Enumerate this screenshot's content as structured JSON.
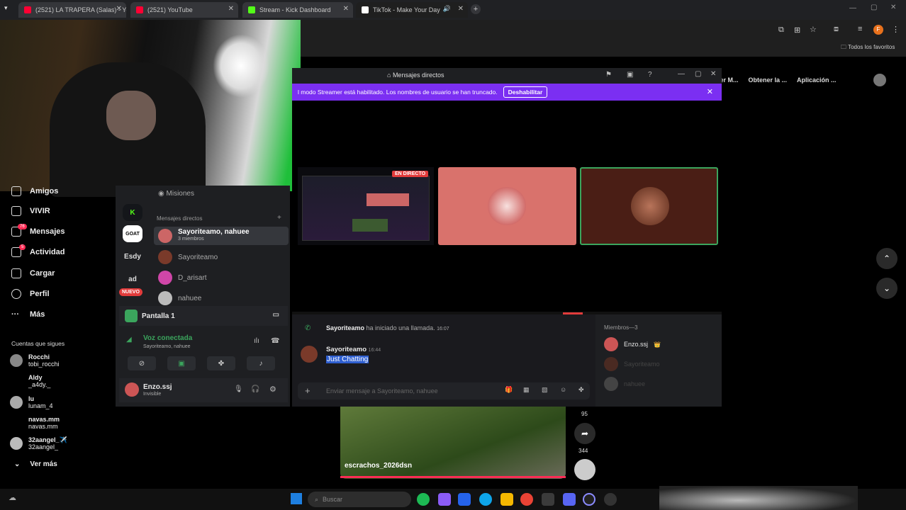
{
  "browser": {
    "tabs": [
      {
        "title": "(2521) LA TRAPERA (Salas) - Yo",
        "color": "#ff0033"
      },
      {
        "title": "(2521) YouTube",
        "color": "#ff0033"
      },
      {
        "title": "Stream - Kick Dashboard",
        "color": "#53fc18"
      },
      {
        "title": "TikTok - Make Your Day",
        "color": "#ffffff"
      }
    ],
    "bookmarks_label": "Todos los favoritos",
    "bookmarks": [
      "ner M...",
      "Obtener la ...",
      "Aplicación ..."
    ],
    "profile_initial": "F"
  },
  "tiktok_sidebar": {
    "items": [
      {
        "label": "Amigos",
        "icon": "friends-icon",
        "badge": ""
      },
      {
        "label": "VIVIR",
        "icon": "live-icon",
        "badge": ""
      },
      {
        "label": "Mensajes",
        "icon": "messages-icon",
        "badge": "76"
      },
      {
        "label": "Actividad",
        "icon": "activity-icon",
        "badge": "5"
      },
      {
        "label": "Cargar",
        "icon": "upload-icon",
        "badge": ""
      },
      {
        "label": "Perfil",
        "icon": "profile-icon",
        "badge": ""
      },
      {
        "label": "Más",
        "icon": "more-icon",
        "badge": ""
      }
    ],
    "following_title": "Cuentas que sigues",
    "accounts": [
      {
        "name": "Rocchi",
        "handle": "tobi_rocchi"
      },
      {
        "name": "Aldy",
        "handle": "_a4dy._"
      },
      {
        "name": "lu",
        "handle": "lunam_4"
      },
      {
        "name": "navas.mm",
        "handle": "navas.mm"
      },
      {
        "name": "32aangel_✈️",
        "handle": "32aangel_"
      }
    ],
    "see_more": "Ver más"
  },
  "discord": {
    "window_title": "Mensajes directos",
    "streamer_text": "l modo Streamer está habilitado. Los nombres de usuario se han truncado.",
    "disable_button": "Deshabilitar",
    "live_badge": "EN DIRECTO",
    "missions": "Misiones",
    "dm_header": "Mensajes directos",
    "dm_add": "+",
    "servers": [
      "K",
      "GOAT",
      "Esdy",
      "ad"
    ],
    "new_badge": "NUEVO",
    "dms": [
      {
        "name": "Sayoriteamo, nahuee",
        "sub": "3 miembros",
        "active": true
      },
      {
        "name": "Sayoriteamo",
        "sub": "",
        "active": false
      },
      {
        "name": "D_arisart",
        "sub": "",
        "active": false
      },
      {
        "name": "nahuee",
        "sub": "",
        "active": false
      }
    ],
    "screen_share_label": "Pantalla 1",
    "voice_status": "Voz conectada",
    "voice_members": "Sayoriteamo, nahuee",
    "user": {
      "name": "Enzo.ssj",
      "status": "Invisible"
    },
    "chat": {
      "call_author": "Sayoriteamo",
      "call_text": "ha iniciado una llamada.",
      "call_time": "16:07",
      "msg_author": "Sayoriteamo",
      "msg_time": "16:44",
      "msg_text": "Just Chatting",
      "input_placeholder": "Enviar mensaje a Sayoriteamo, nahuee"
    },
    "members_title": "Miembros—3",
    "members": [
      {
        "name": "Enzo.ssj",
        "crown": "👑"
      },
      {
        "name": "Sayoriteamo",
        "crown": ""
      },
      {
        "name": "nahuee",
        "crown": ""
      }
    ]
  },
  "tiktok_video": {
    "username": "escrachos_2026dsn",
    "shares": "95",
    "comments": "344"
  },
  "taskbar": {
    "search_placeholder": "Buscar"
  },
  "colors": {
    "discord_purple": "#7b2ff2",
    "tile_pink": "#d9726c",
    "tile_brown": "#4a1e15",
    "tile_border_green": "#3ba55d"
  }
}
